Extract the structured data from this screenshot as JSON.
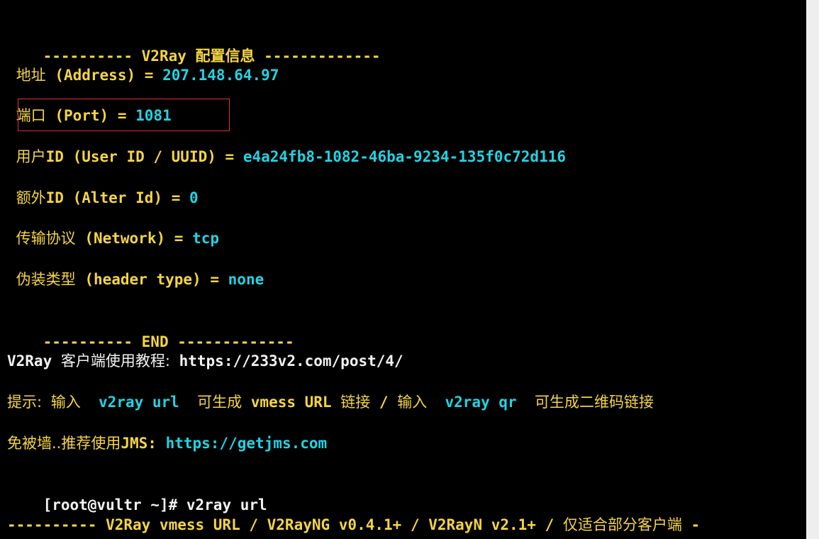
{
  "terminal": {
    "header_start": "---------- V2Ray 配置信息 -------------",
    "address": {
      "label_cn": "地址",
      "label_en": "(Address)",
      "eq": "=",
      "value": "207.148.64.97"
    },
    "port": {
      "label_cn": "端口",
      "label_en": "(Port)",
      "eq": "=",
      "value": "1081"
    },
    "user_id": {
      "label_cn": "用户",
      "label_en": "ID (User ID / UUID)",
      "eq": "=",
      "value": "e4a24fb8-1082-46ba-9234-135f0c72d116"
    },
    "alter_id": {
      "label_cn": "额外",
      "label_en": "ID (Alter Id)",
      "eq": "=",
      "value": "0"
    },
    "network": {
      "label_cn": "传输协议",
      "label_en": "(Network)",
      "eq": "=",
      "value": "tcp"
    },
    "header_type": {
      "label_cn": "伪装类型",
      "label_en": "(header type)",
      "eq": "=",
      "value": "none"
    },
    "header_end": "---------- END -------------",
    "tutorial": {
      "prefix": "V2Ray",
      "text_cn": "客户端使用教程:",
      "url": "https://233v2.com/post/4/"
    },
    "tip": {
      "label": "提示:",
      "input1": "输入",
      "cmd1": "v2ray url",
      "desc1_cn": "可生成",
      "desc1_en": "vmess URL",
      "desc1_cn2": "链接",
      "sep": "/",
      "input2": "输入",
      "cmd2": "v2ray qr",
      "desc2_cn": "可生成二维码链接"
    },
    "jms": {
      "text_cn": "免被墙..推荐使用",
      "text_en": "JMS:",
      "url": "https://getjms.com"
    },
    "prompt": {
      "text": "[root@vultr ~]# v2ray url"
    },
    "url_header": {
      "text_en": "---------- V2Ray vmess URL / V2RayNG v0.4.1+ / V2RayN v2.1+ /",
      "text_cn": "仅适合部分客户端",
      "tail": " -"
    }
  },
  "colors": {
    "background": "#000000",
    "yellow": "#f4d545",
    "cyan": "#22d3e3",
    "white": "#f2f2f2",
    "highlight_border": "#e03030"
  }
}
